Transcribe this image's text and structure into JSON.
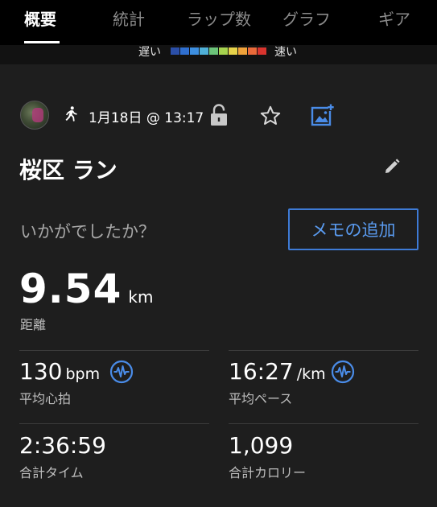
{
  "tabs": [
    {
      "label": "概要",
      "active": true
    },
    {
      "label": "統計",
      "active": false
    },
    {
      "label": "ラップ数",
      "active": false
    },
    {
      "label": "グラフ",
      "active": false
    },
    {
      "label": "ギア",
      "active": false
    }
  ],
  "legend": {
    "slow": "遅い",
    "fast": "速い",
    "colors": [
      "#2b4fa8",
      "#2f6fd0",
      "#3d8fe0",
      "#4fb0d8",
      "#6cc47a",
      "#a6d34f",
      "#e6d24a",
      "#f0a23a",
      "#ea6a3a",
      "#d9342e"
    ]
  },
  "meta": {
    "date": "1月18日 @ 13:17"
  },
  "activity": {
    "title": "桜区 ラン",
    "question": "いかがでしたか？",
    "memo_button": "メモの追加"
  },
  "distance": {
    "value": "9.54",
    "unit": "km",
    "label": "距離"
  },
  "stats": {
    "heart_rate": {
      "value": "130",
      "unit": "bpm",
      "label": "平均心拍"
    },
    "pace": {
      "value": "16:27",
      "unit": "/km",
      "label": "平均ペース"
    },
    "time": {
      "value": "2:36:59",
      "label": "合計タイム"
    },
    "calories": {
      "value": "1,099",
      "label": "合計カロリー"
    }
  },
  "colors": {
    "accent": "#3e7bd6",
    "background": "#1e1e1e",
    "tabbar": "#000000"
  }
}
